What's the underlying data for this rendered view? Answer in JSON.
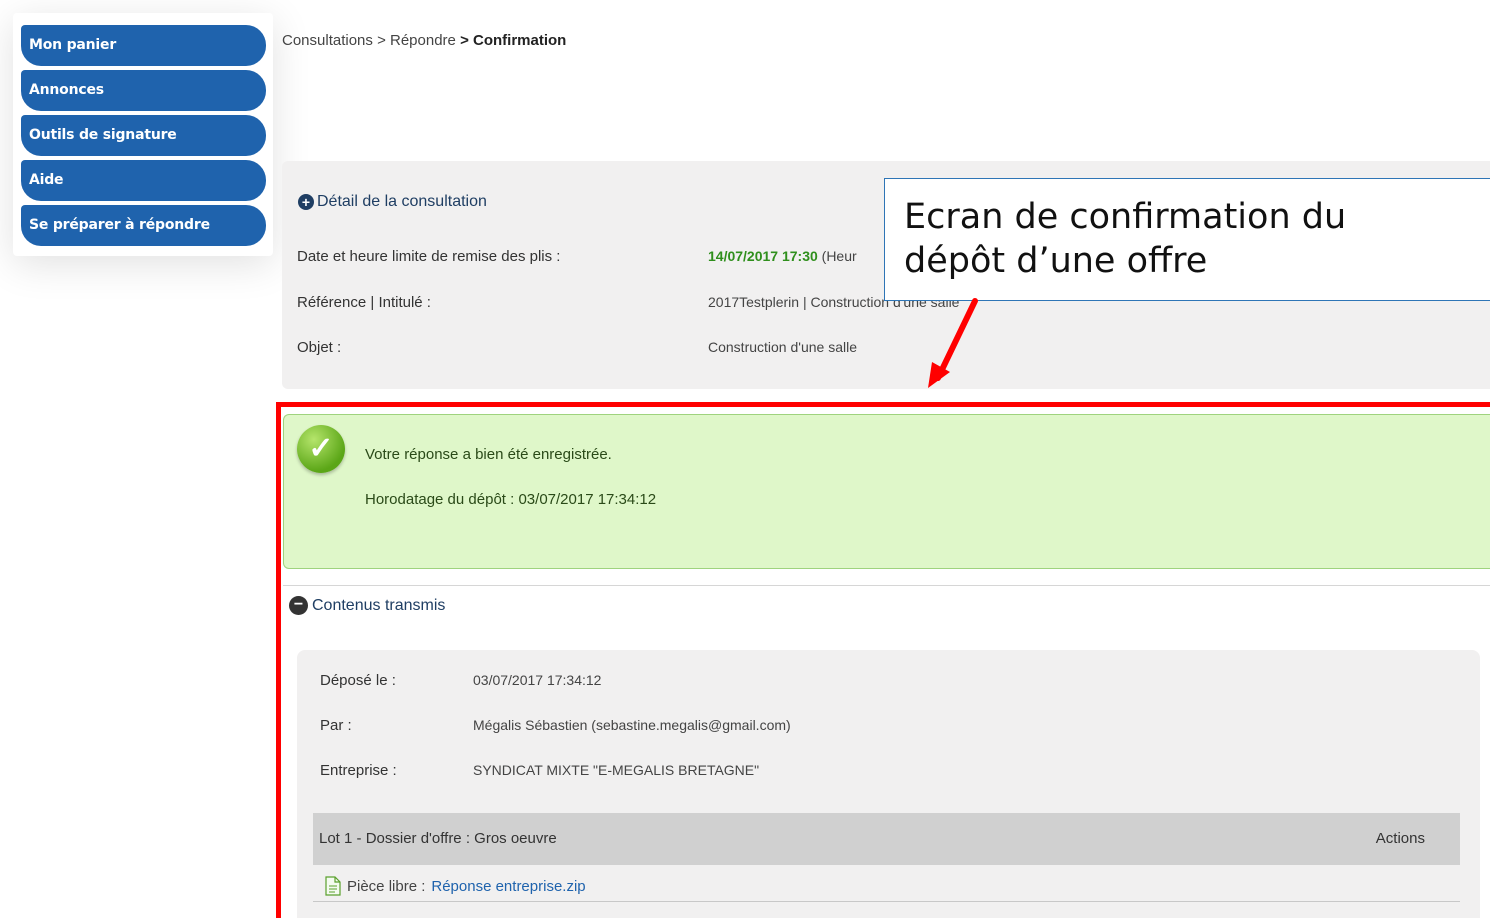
{
  "sidebar": {
    "items": [
      {
        "label": "Mon panier"
      },
      {
        "label": "Annonces"
      },
      {
        "label": "Outils de signature"
      },
      {
        "label": "Aide"
      },
      {
        "label": "Se préparer à répondre"
      }
    ]
  },
  "breadcrumb": {
    "part1": "Consultations",
    "sep1": ">",
    "part2": "Répondre",
    "sep2": ">",
    "current": "Confirmation"
  },
  "detail": {
    "title": "Détail de la consultation",
    "rows": [
      {
        "label": "Date et heure limite de remise des plis :",
        "value": "14/07/2017 17:30",
        "value_suffix": "(Heur"
      },
      {
        "label": "Référence | Intitulé :",
        "value": "2017Testplerin | Construction d'une salle"
      },
      {
        "label": "Objet :",
        "value": "Construction d'une salle"
      }
    ]
  },
  "callout": {
    "line1": "Ecran de confirmation du",
    "line2": "dépôt d’une offre"
  },
  "success": {
    "message": "Votre réponse a bien été enregistrée.",
    "timestamp_label": "Horodatage du dépôt :",
    "timestamp_value": "03/07/2017 17:34:12"
  },
  "contenus": {
    "title": "Contenus transmis",
    "rows": [
      {
        "label": "Déposé le :",
        "value": "03/07/2017 17:34:12"
      },
      {
        "label": "Par :",
        "value": "Mégalis Sébastien (sebastine.megalis@gmail.com)"
      },
      {
        "label": "Entreprise :",
        "value": "SYNDICAT MIXTE \"E-MEGALIS BRETAGNE\""
      }
    ],
    "lot_title": "Lot 1 - Dossier d'offre : Gros oeuvre",
    "actions_label": "Actions",
    "file_prefix": "Pièce libre :",
    "file_name": "Réponse entreprise.zip"
  },
  "colors": {
    "nav_blue": "#1f63ad",
    "highlight_red": "#ff0000",
    "success_green": "#dff7c9",
    "date_green": "#2f8f1c"
  }
}
